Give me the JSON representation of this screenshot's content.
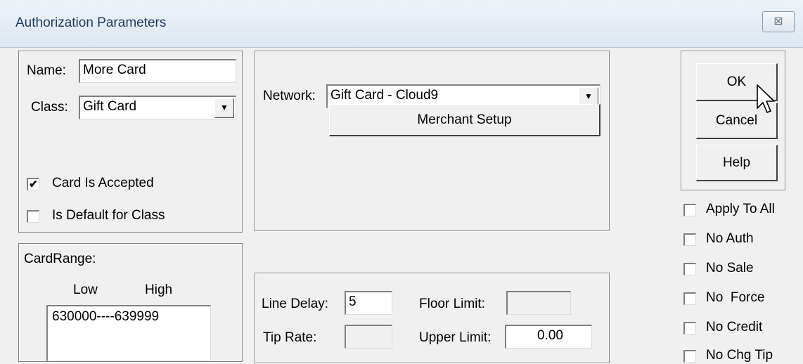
{
  "window": {
    "title": "Authorization Parameters",
    "close_glyph": "⊠"
  },
  "card": {
    "name_label": "Name:",
    "name_value": "More Card",
    "class_label": "Class:",
    "class_value": "Gift Card",
    "accepted_label": "Card Is Accepted",
    "accepted_checked": true,
    "default_label": "Is Default for Class",
    "default_checked": false
  },
  "network": {
    "label": "Network:",
    "value": "Gift Card - Cloud9",
    "merchant_button": "Merchant Setup"
  },
  "buttons": {
    "ok": "OK",
    "cancel": "Cancel",
    "help": "Help"
  },
  "options": [
    {
      "label": "Apply To All",
      "checked": false
    },
    {
      "label": "No Auth",
      "checked": false
    },
    {
      "label": "No Sale",
      "checked": false
    },
    {
      "label": "No  Force",
      "checked": false
    },
    {
      "label": "No Credit",
      "checked": false
    },
    {
      "label": "No Chg Tip",
      "checked": false
    }
  ],
  "card_range": {
    "title": "CardRange:",
    "low_header": "Low",
    "high_header": "High",
    "entries": [
      "630000----639999"
    ]
  },
  "limits": {
    "line_delay_label": "Line Delay:",
    "line_delay_value": "5",
    "floor_limit_label": "Floor Limit:",
    "floor_limit_value": "",
    "tip_rate_label": "Tip Rate:",
    "tip_rate_value": "",
    "upper_limit_label": "Upper Limit:",
    "upper_limit_value": "0.00"
  },
  "icons": {
    "dropdown": "chevron-down-icon",
    "cursor": "mouse-pointer-icon"
  },
  "colors": {
    "window_bg": "#f0f0f0",
    "title_text": "#1e3a5f"
  }
}
